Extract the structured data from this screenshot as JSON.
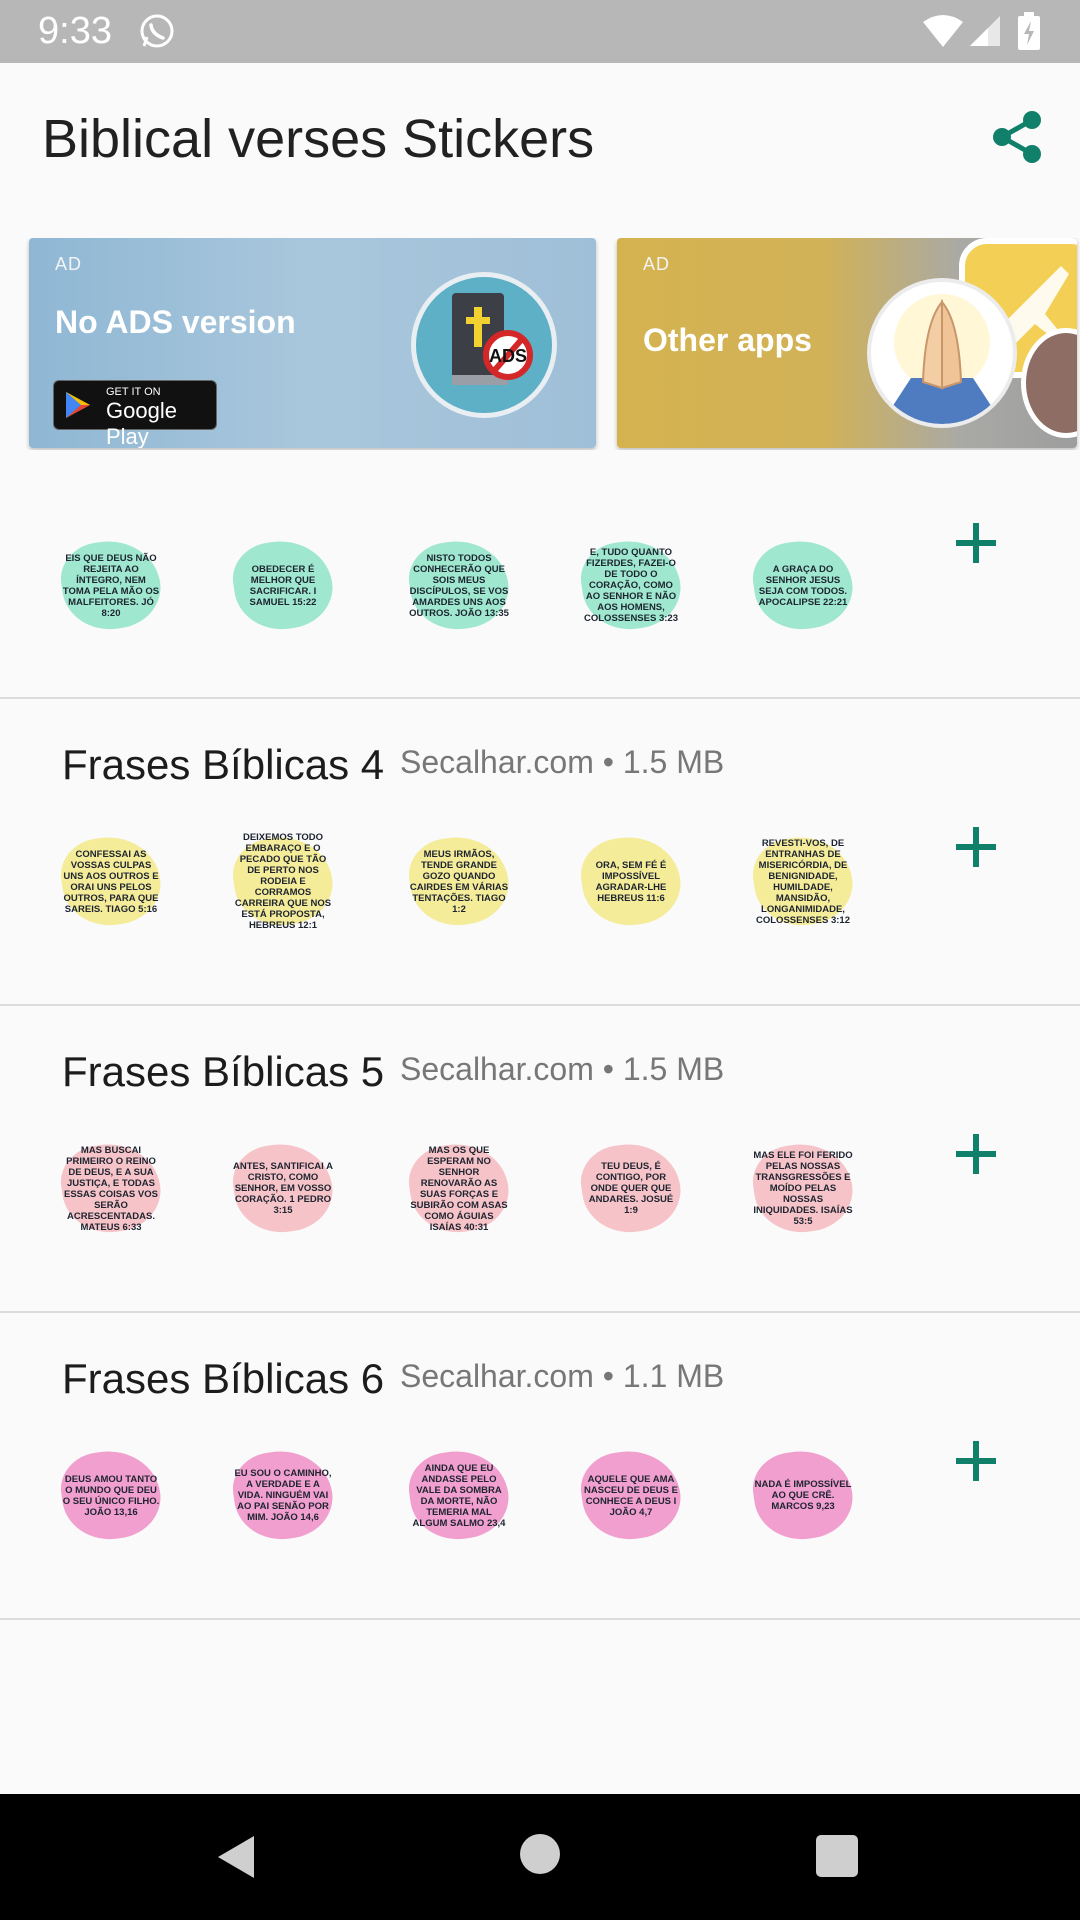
{
  "status_bar": {
    "time": "9:33"
  },
  "app_bar": {
    "title": "Biblical verses Stickers"
  },
  "ads": [
    {
      "badge": "AD",
      "title": "No ADS version",
      "store_small": "GET IT ON",
      "store_big": "Google Play",
      "logo_text": "ADS"
    },
    {
      "badge": "AD",
      "title": "Other apps"
    }
  ],
  "packs": [
    {
      "name": "",
      "meta": "",
      "sticker_color": "#9fe8cf",
      "stickers": [
        "EIS QUE DEUS NÃO REJEITA AO ÍNTEGRO, NEM TOMA PELA MÃO OS MALFEITORES. JÓ 8:20",
        "OBEDECER É MELHOR QUE SACRIFICAR. I SAMUEL 15:22",
        "NISTO TODOS CONHECERÃO QUE SOIS MEUS DISCÍPULOS, SE VOS AMARDES UNS AOS OUTROS. JOÃO 13:35",
        "E, TUDO QUANTO FIZERDES, FAZEI-O DE TODO O CORAÇÃO, COMO AO SENHOR E NÃO AOS HOMENS, COLOSSENSES 3:23",
        "A GRAÇA DO SENHOR JESUS SEJA COM TODOS. APOCALIPSE 22:21"
      ]
    },
    {
      "name": "Frases Bíblicas 4",
      "meta": "Secalhar.com • 1.5 MB",
      "sticker_color": "#f5ec9a",
      "stickers": [
        "CONFESSAI AS VOSSAS CULPAS UNS AOS OUTROS E ORAI UNS PELOS OUTROS, PARA QUE SAREIS. TIAGO 5:16",
        "DEIXEMOS TODO EMBARAÇO E O PECADO QUE TÃO DE PERTO NOS RODEIA E CORRAMOS CARREIRA QUE NOS ESTÁ PROPOSTA, HEBREUS 12:1",
        "MEUS IRMÃOS, TENDE GRANDE GOZO QUANDO CAIRDES EM VÁRIAS TENTAÇÕES. TIAGO 1:2",
        "ORA, SEM FÉ É IMPOSSÍVEL AGRADAR-LHE HEBREUS 11:6",
        "REVESTI-VOS, DE ENTRANHAS DE MISERICÓRDIA, DE BENIGNIDADE, HUMILDADE, MANSIDÃO, LONGANIMIDADE, COLOSSENSES 3:12"
      ]
    },
    {
      "name": "Frases Bíblicas 5",
      "meta": "Secalhar.com • 1.5 MB",
      "sticker_color": "#f6c4c8",
      "stickers": [
        "MAS BUSCAI PRIMEIRO O REINO DE DEUS, E A SUA JUSTIÇA, E TODAS ESSAS COISAS VOS SERÃO ACRESCENTADAS. MATEUS 6:33",
        "ANTES, SANTIFICAI A CRISTO, COMO SENHOR, EM VOSSO CORAÇÃO. 1 PEDRO 3:15",
        "MAS OS QUE ESPERAM NO SENHOR RENOVARÃO AS SUAS FORÇAS E SUBIRÃO COM ASAS COMO ÁGUIAS ISAÍAS 40:31",
        "TEU DEUS, É CONTIGO, POR ONDE QUER QUE ANDARES. JOSUÉ 1:9",
        "MAS ELE FOI FERIDO PELAS NOSSAS TRANSGRESSÕES E MOÍDO PELAS NOSSAS INIQUIDADES. ISAÍAS 53:5"
      ]
    },
    {
      "name": "Frases Bíblicas 6",
      "meta": "Secalhar.com • 1.1 MB",
      "sticker_color": "#f19fce",
      "stickers": [
        "DEUS AMOU TANTO O MUNDO QUE DEU O SEU ÚNICO FILHO. JOÃO 13,16",
        "EU SOU O CAMINHO, A VERDADE E A VIDA. NINGUÉM VAI AO PAI SENÃO POR MIM. JOÃO 14,6",
        "AINDA QUE EU ANDASSE PELO VALE DA SOMBRA DA MORTE, NÃO TEMERIA MAL ALGUM SALMO 23,4",
        "AQUELE QUE AMA NASCEU DE DEUS E CONHECE A DEUS I JOÃO 4,7",
        "NADA É IMPOSSÍVEL AO QUE CRÊ. MARCOS 9,23"
      ]
    }
  ],
  "colors": {
    "accent": "#11806a",
    "status_bar": "#b7b7b7",
    "nav_bar": "#000000"
  }
}
